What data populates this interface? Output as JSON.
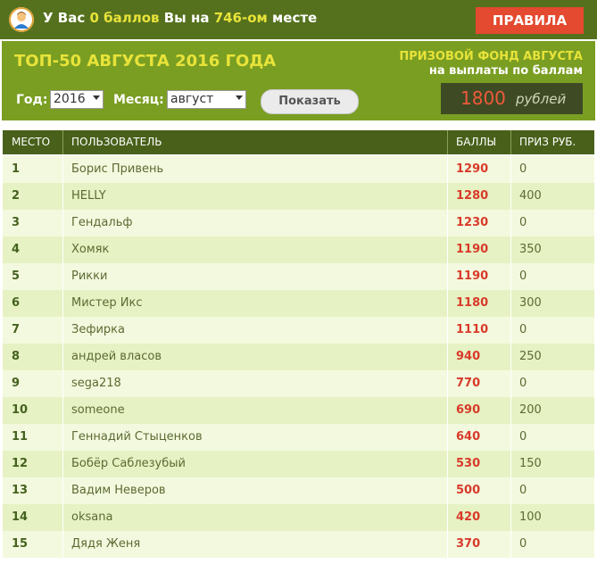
{
  "topbar": {
    "prefix": "У Вас",
    "points": "0 баллов",
    "middle": "Вы на",
    "place": "746-ом",
    "suffix": "месте",
    "rules_label": "ПРАВИЛА"
  },
  "header": {
    "title": "ТОП-50 АВГУСТА 2016 ГОДА",
    "prize_line1": "ПРИЗОВОЙ ФОНД АВГУСТА",
    "prize_line2": "на выплаты по баллам",
    "prize_amount": "1800",
    "prize_currency": "рублей"
  },
  "filters": {
    "year_label": "Год:",
    "year_value": "2016",
    "month_label": "Месяц:",
    "month_value": "август",
    "show_label": "Показать"
  },
  "table": {
    "columns": [
      "МЕСТО",
      "ПОЛЬЗОВАТЕЛЬ",
      "БАЛЛЫ",
      "ПРИЗ РУБ."
    ],
    "rows": [
      {
        "place": "1",
        "user": "Борис Привень",
        "score": "1290",
        "prize": "0"
      },
      {
        "place": "2",
        "user": "HELLY",
        "score": "1280",
        "prize": "400"
      },
      {
        "place": "3",
        "user": "Гендальф",
        "score": "1230",
        "prize": "0"
      },
      {
        "place": "4",
        "user": "Хомяк",
        "score": "1190",
        "prize": "350"
      },
      {
        "place": "5",
        "user": "Рикки",
        "score": "1190",
        "prize": "0"
      },
      {
        "place": "6",
        "user": "Мистер Икс",
        "score": "1180",
        "prize": "300"
      },
      {
        "place": "7",
        "user": "Зефирка",
        "score": "1110",
        "prize": "0"
      },
      {
        "place": "8",
        "user": "андрей власов",
        "score": "940",
        "prize": "250"
      },
      {
        "place": "9",
        "user": "sega218",
        "score": "770",
        "prize": "0"
      },
      {
        "place": "10",
        "user": "someone",
        "score": "690",
        "prize": "200"
      },
      {
        "place": "11",
        "user": "Геннадий Стыценков",
        "score": "640",
        "prize": "0"
      },
      {
        "place": "12",
        "user": "Бобёр Саблезубый",
        "score": "530",
        "prize": "150"
      },
      {
        "place": "13",
        "user": "Вадим Неверов",
        "score": "500",
        "prize": "0"
      },
      {
        "place": "14",
        "user": "oksana",
        "score": "420",
        "prize": "100"
      },
      {
        "place": "15",
        "user": "Дядя Женя",
        "score": "370",
        "prize": "0"
      }
    ]
  },
  "colors": {
    "topbar_bg": "#55711e",
    "header_bg": "#7a9e22",
    "accent_yellow": "#e8e33a",
    "rules_red": "#e44a2f",
    "score_red": "#d83a2a",
    "table_head_bg": "#48601a",
    "row_light": "#f3f9de",
    "row_dark": "#e6f2c3"
  },
  "icons": {
    "avatar": "user-avatar-icon",
    "select_arrow": "chevron-down-icon"
  }
}
